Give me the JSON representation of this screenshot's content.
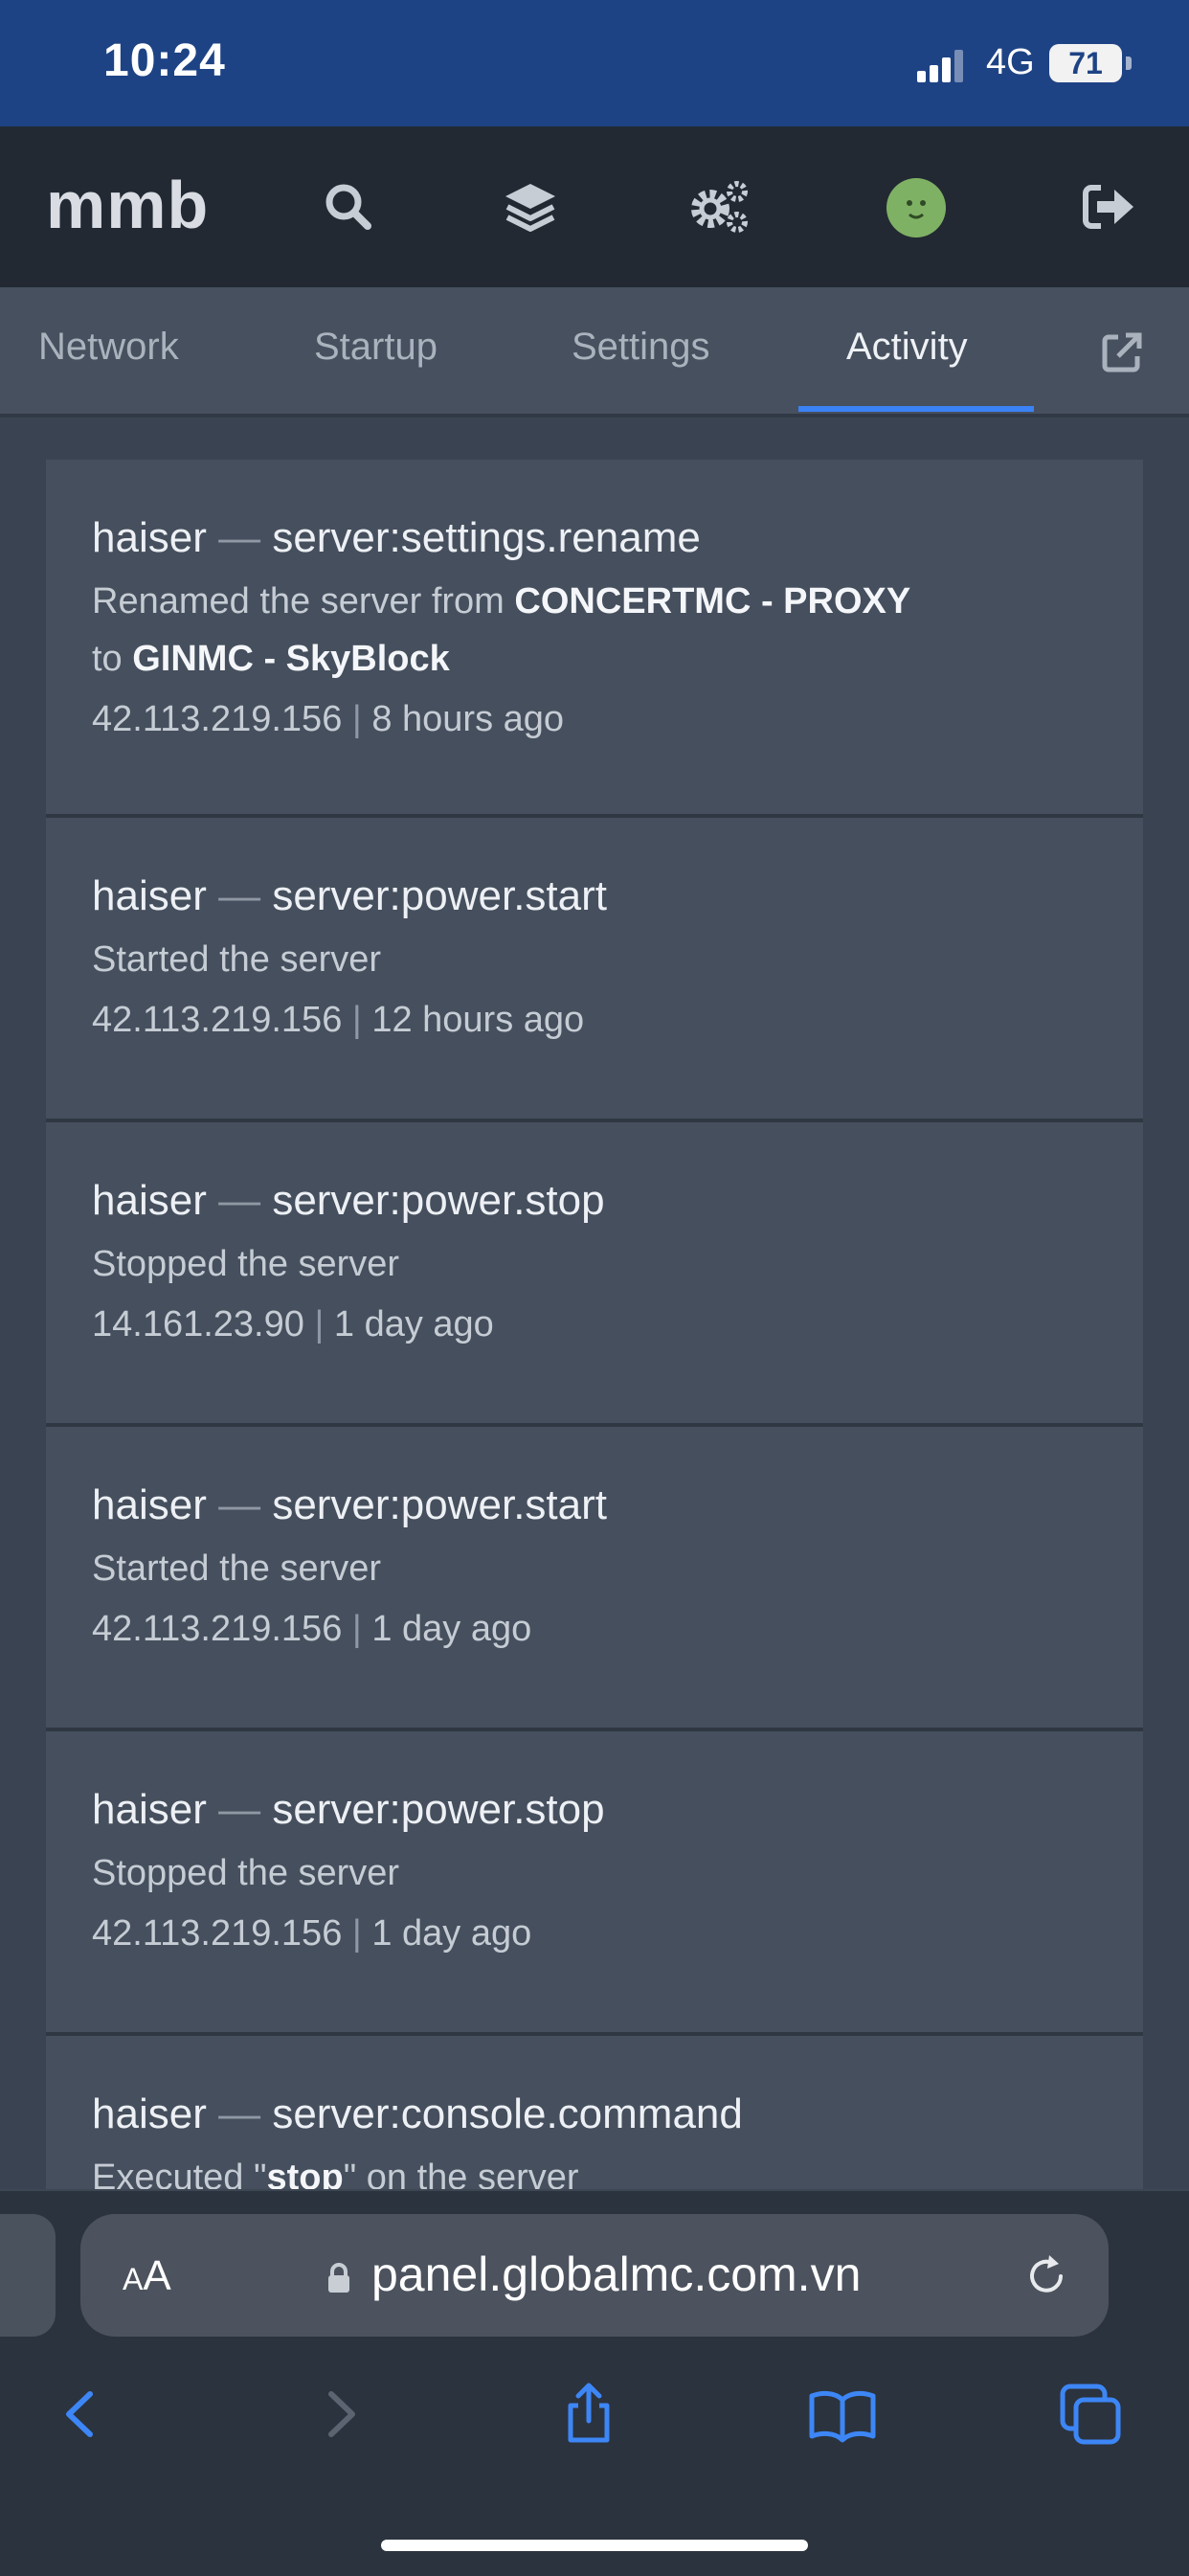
{
  "status_bar": {
    "time": "10:24",
    "network": "4G",
    "battery": "71"
  },
  "header": {
    "brand": "mmb",
    "icons": [
      "search-icon",
      "layers-icon",
      "cogs-icon",
      "avatar",
      "sign-out-icon"
    ]
  },
  "tabs": [
    {
      "label": "Network",
      "active": false
    },
    {
      "label": "Startup",
      "active": false
    },
    {
      "label": "Settings",
      "active": false
    },
    {
      "label": "Activity",
      "active": true
    }
  ],
  "tabs_extra_icon": "external-link-icon",
  "activity": [
    {
      "user": "haiser",
      "sep": "—",
      "event": "server:settings.rename",
      "desc_pre": "Renamed the server from ",
      "desc_from": "CONCERTMC - PROXY",
      "desc_mid": "to ",
      "desc_to": "GINMC - SkyBlock",
      "ip": "42.113.219.156",
      "time": "8 hours ago"
    },
    {
      "user": "haiser",
      "sep": "—",
      "event": "server:power.start",
      "desc": "Started the server",
      "ip": "42.113.219.156",
      "time": "12 hours ago"
    },
    {
      "user": "haiser",
      "sep": "—",
      "event": "server:power.stop",
      "desc": "Stopped the server",
      "ip": "14.161.23.90",
      "time": "1 day ago"
    },
    {
      "user": "haiser",
      "sep": "—",
      "event": "server:power.start",
      "desc": "Started the server",
      "ip": "42.113.219.156",
      "time": "1 day ago"
    },
    {
      "user": "haiser",
      "sep": "—",
      "event": "server:power.stop",
      "desc": "Stopped the server",
      "ip": "42.113.219.156",
      "time": "1 day ago"
    },
    {
      "user": "haiser",
      "sep": "—",
      "event": "server:console.command",
      "desc_pre": "Executed \"",
      "desc_cmd": "stop",
      "desc_post": "\" on the server"
    }
  ],
  "meta_separator": "|",
  "browser": {
    "text_size_label_small": "A",
    "text_size_label": "A",
    "url": "panel.globalmc.com.vn",
    "toolbar": [
      "back-icon",
      "forward-icon",
      "share-icon",
      "bookmarks-icon",
      "tabs-icon"
    ]
  }
}
